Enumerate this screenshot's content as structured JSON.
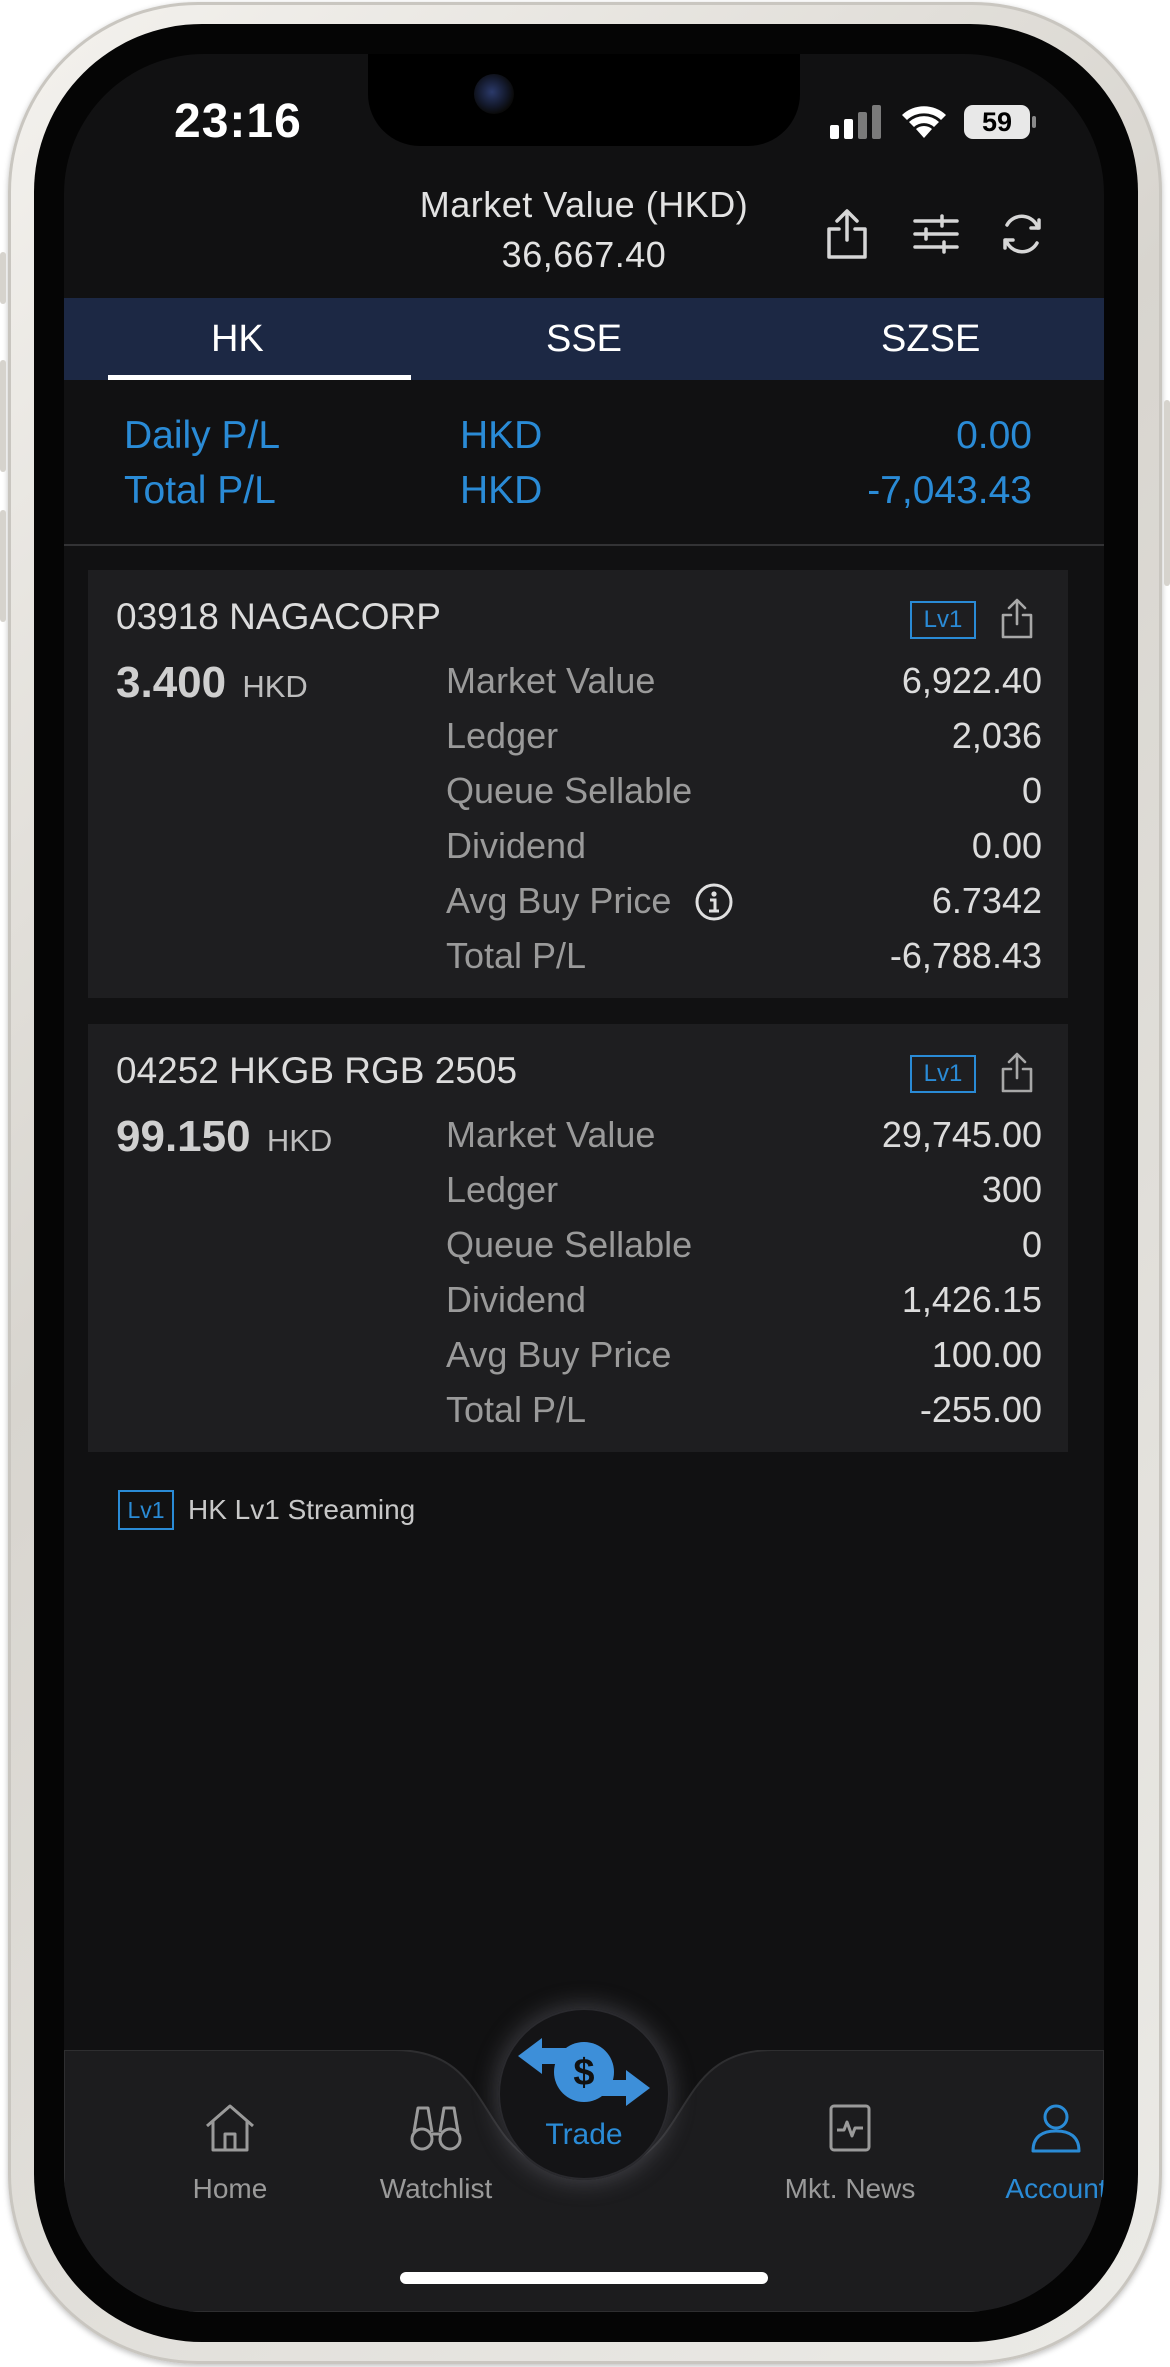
{
  "status_bar": {
    "time": "23:16",
    "battery": "59"
  },
  "header": {
    "title": "Market Value (HKD)",
    "value": "36,667.40"
  },
  "tabs": [
    {
      "label": "HK",
      "active": true
    },
    {
      "label": "SSE",
      "active": false
    },
    {
      "label": "SZSE",
      "active": false
    }
  ],
  "summary": {
    "daily": {
      "label": "Daily P/L",
      "currency": "HKD",
      "value": "0.00"
    },
    "total": {
      "label": "Total P/L",
      "currency": "HKD",
      "value": "-7,043.43"
    }
  },
  "holdings": [
    {
      "symbol": "03918 NAGACORP",
      "price": "3.400",
      "currency": "HKD",
      "badge": "Lv1",
      "rows": [
        {
          "label": "Market Value",
          "value": "6,922.40"
        },
        {
          "label": "Ledger",
          "value": "2,036"
        },
        {
          "label": "Queue Sellable",
          "value": "0"
        },
        {
          "label": "Dividend",
          "value": "0.00"
        },
        {
          "label": "Avg Buy Price",
          "value": "6.7342"
        },
        {
          "label": "Total P/L",
          "value": "-6,788.43"
        }
      ]
    },
    {
      "symbol": "04252 HKGB RGB 2505",
      "price": "99.150",
      "currency": "HKD",
      "badge": "Lv1",
      "rows": [
        {
          "label": "Market Value",
          "value": "29,745.00"
        },
        {
          "label": "Ledger",
          "value": "300"
        },
        {
          "label": "Queue Sellable",
          "value": "0"
        },
        {
          "label": "Dividend",
          "value": "1,426.15"
        },
        {
          "label": "Avg Buy Price",
          "value": "100.00"
        },
        {
          "label": "Total P/L",
          "value": "-255.00"
        }
      ]
    }
  ],
  "streaming": {
    "badge": "Lv1",
    "text": "HK Lv1 Streaming"
  },
  "nav": {
    "home": "Home",
    "watchlist": "Watchlist",
    "trade": "Trade",
    "news": "Mkt. News",
    "account": "Account"
  },
  "colors": {
    "accent": "#2a8bd6",
    "tab_bar": "#1c2844",
    "background": "#111112",
    "card": "#1e1e20"
  },
  "icons": [
    "share-icon",
    "filter-icon",
    "refresh-icon",
    "info-icon",
    "home-icon",
    "binoculars-icon",
    "trade-icon",
    "news-icon",
    "account-icon",
    "signal-icon",
    "wifi-icon"
  ]
}
